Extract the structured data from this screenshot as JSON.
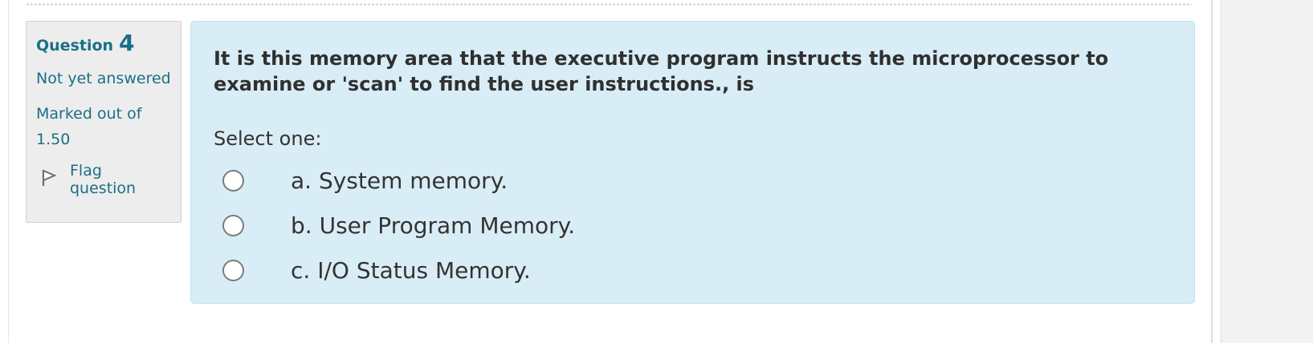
{
  "question": {
    "label": "Question",
    "number": "4",
    "state": "Not yet answered",
    "grade": "Marked out of 1.50",
    "flag_label": "Flag question",
    "text": "It is this memory area that the executive program instructs the microprocessor to examine or 'scan' to find the user instructions., is",
    "prompt": "Select one:",
    "options": [
      {
        "label": "a. System memory."
      },
      {
        "label": "b. User Program Memory."
      },
      {
        "label": "c. I/O Status Memory."
      }
    ]
  },
  "colors": {
    "accent": "#1b6f86",
    "info_bg": "#ededed",
    "content_bg": "#d9edf6"
  },
  "icons": {
    "flag": "flag-icon"
  }
}
